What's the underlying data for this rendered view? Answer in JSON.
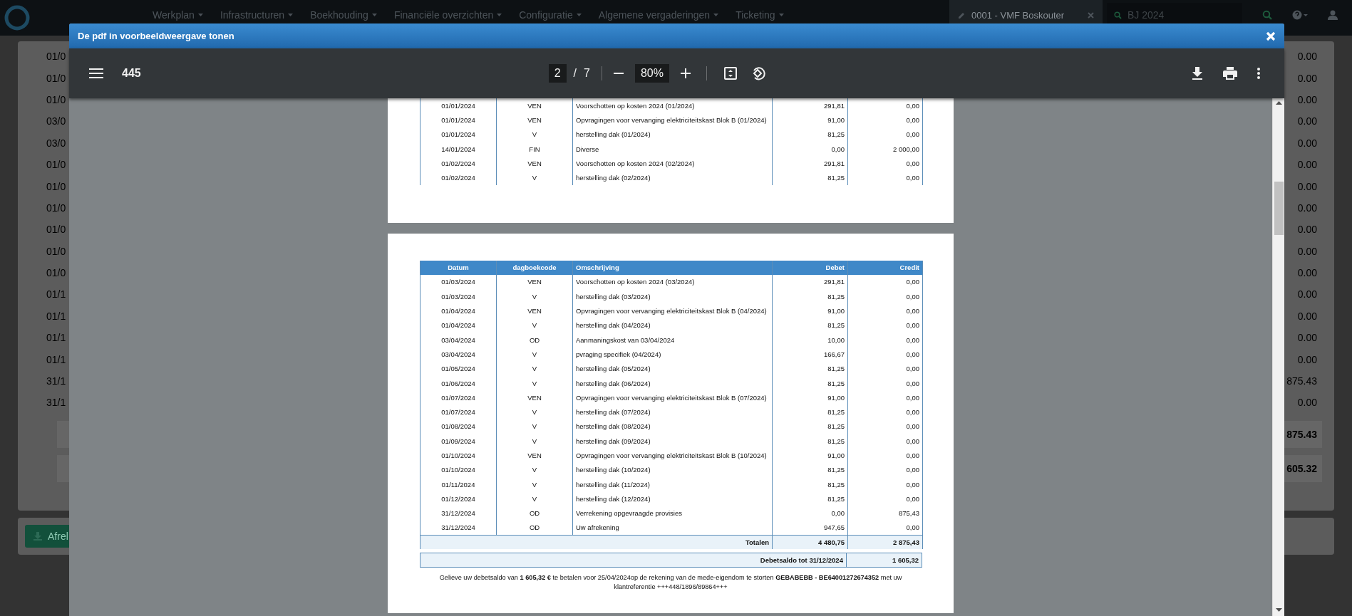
{
  "app_nav": {
    "items": [
      "Werkplan",
      "Infrastructuren",
      "Boekhouding",
      "Financiële overzichten",
      "Configuratie",
      "Algemene vergaderingen",
      "Ticketing"
    ],
    "property_tab": {
      "label": "0001 - VMF Boskouter"
    },
    "year_search": {
      "value": "BJ 2024"
    }
  },
  "background_table": {
    "dates": [
      "01/0",
      "01/0",
      "01/0",
      "03/0",
      "03/0",
      "01/0",
      "01/0",
      "01/0",
      "01/0",
      "01/0",
      "01/0",
      "01/1",
      "01/1",
      "01/1",
      "01/1",
      "31/1",
      "31/1"
    ],
    "amounts": [
      "0.00",
      "0.00",
      "0.00",
      "0.00",
      "0.00",
      "0.00",
      "0.00",
      "0.00",
      "0.00",
      "0.00",
      "0.00",
      "0.00",
      "0.00",
      "0.00",
      "0.00",
      "875.43",
      "0.00"
    ],
    "summary_amounts": [
      "875.43",
      "605.32"
    ]
  },
  "background_button": {
    "label": "Afrel"
  },
  "modal": {
    "title": "De pdf in voorbeeldweergave tonen",
    "toolbar": {
      "document_title": "445",
      "page": "2",
      "page_separator": "/",
      "page_count": "7",
      "zoom": "80%"
    },
    "pages": [
      {
        "rows": [
          [
            "01/01/2024",
            "VEN",
            "Voorschotten op kosten 2024 (01/2024)",
            "291,81",
            "0,00"
          ],
          [
            "01/01/2024",
            "VEN",
            "Opvragingen voor vervanging elektriciteitskast Blok B (01/2024)",
            "91,00",
            "0,00"
          ],
          [
            "01/01/2024",
            "V",
            "herstelling dak (01/2024)",
            "81,25",
            "0,00"
          ],
          [
            "14/01/2024",
            "FIN",
            "Diverse",
            "0,00",
            "2 000,00"
          ],
          [
            "01/02/2024",
            "VEN",
            "Voorschotten op kosten 2024 (02/2024)",
            "291,81",
            "0,00"
          ],
          [
            "01/02/2024",
            "V",
            "herstelling dak (02/2024)",
            "81,25",
            "0,00"
          ]
        ]
      },
      {
        "columns": [
          "Datum",
          "dagboekcode",
          "Omschrijving",
          "Debet",
          "Credit"
        ],
        "rows": [
          [
            "01/03/2024",
            "VEN",
            "Voorschotten op kosten 2024 (03/2024)",
            "291,81",
            "0,00"
          ],
          [
            "01/03/2024",
            "V",
            "herstelling dak (03/2024)",
            "81,25",
            "0,00"
          ],
          [
            "01/04/2024",
            "VEN",
            "Opvragingen voor vervanging elektriciteitskast Blok B (04/2024)",
            "91,00",
            "0,00"
          ],
          [
            "01/04/2024",
            "V",
            "herstelling dak (04/2024)",
            "81,25",
            "0,00"
          ],
          [
            "03/04/2024",
            "OD",
            "Aanmaningskost van 03/04/2024",
            "10,00",
            "0,00"
          ],
          [
            "03/04/2024",
            "V",
            "pvraging specifiek (04/2024)",
            "166,67",
            "0,00"
          ],
          [
            "01/05/2024",
            "V",
            "herstelling dak (05/2024)",
            "81,25",
            "0,00"
          ],
          [
            "01/06/2024",
            "V",
            "herstelling dak (06/2024)",
            "81,25",
            "0,00"
          ],
          [
            "01/07/2024",
            "VEN",
            "Opvragingen voor vervanging elektriciteitskast Blok B (07/2024)",
            "91,00",
            "0,00"
          ],
          [
            "01/07/2024",
            "V",
            "herstelling dak (07/2024)",
            "81,25",
            "0,00"
          ],
          [
            "01/08/2024",
            "V",
            "herstelling dak (08/2024)",
            "81,25",
            "0,00"
          ],
          [
            "01/09/2024",
            "V",
            "herstelling dak (09/2024)",
            "81,25",
            "0,00"
          ],
          [
            "01/10/2024",
            "VEN",
            "Opvragingen voor vervanging elektriciteitskast Blok B (10/2024)",
            "91,00",
            "0,00"
          ],
          [
            "01/10/2024",
            "V",
            "herstelling dak (10/2024)",
            "81,25",
            "0,00"
          ],
          [
            "01/11/2024",
            "V",
            "herstelling dak (11/2024)",
            "81,25",
            "0,00"
          ],
          [
            "01/12/2024",
            "V",
            "herstelling dak (12/2024)",
            "81,25",
            "0,00"
          ],
          [
            "31/12/2024",
            "OD",
            "Verrekening opgevraagde provisies",
            "0,00",
            "875,43"
          ],
          [
            "31/12/2024",
            "OD",
            "Uw afrekening",
            "947,65",
            "0,00"
          ]
        ],
        "totals": {
          "label": "Totalen",
          "debet": "4 480,75",
          "credit": "2 875,43"
        },
        "balance": {
          "label": "Debetsaldo tot 31/12/2024",
          "value": "1 605,32"
        },
        "note": "Gelieve uw debetsaldo van **1 605,32 €** te betalen voor 25/04/2024op de rekening van de mede-eigendom te storten **GEBABEBB - BE64001272674352** met uw klantreferentie +++448/1896/89864+++"
      }
    ]
  }
}
